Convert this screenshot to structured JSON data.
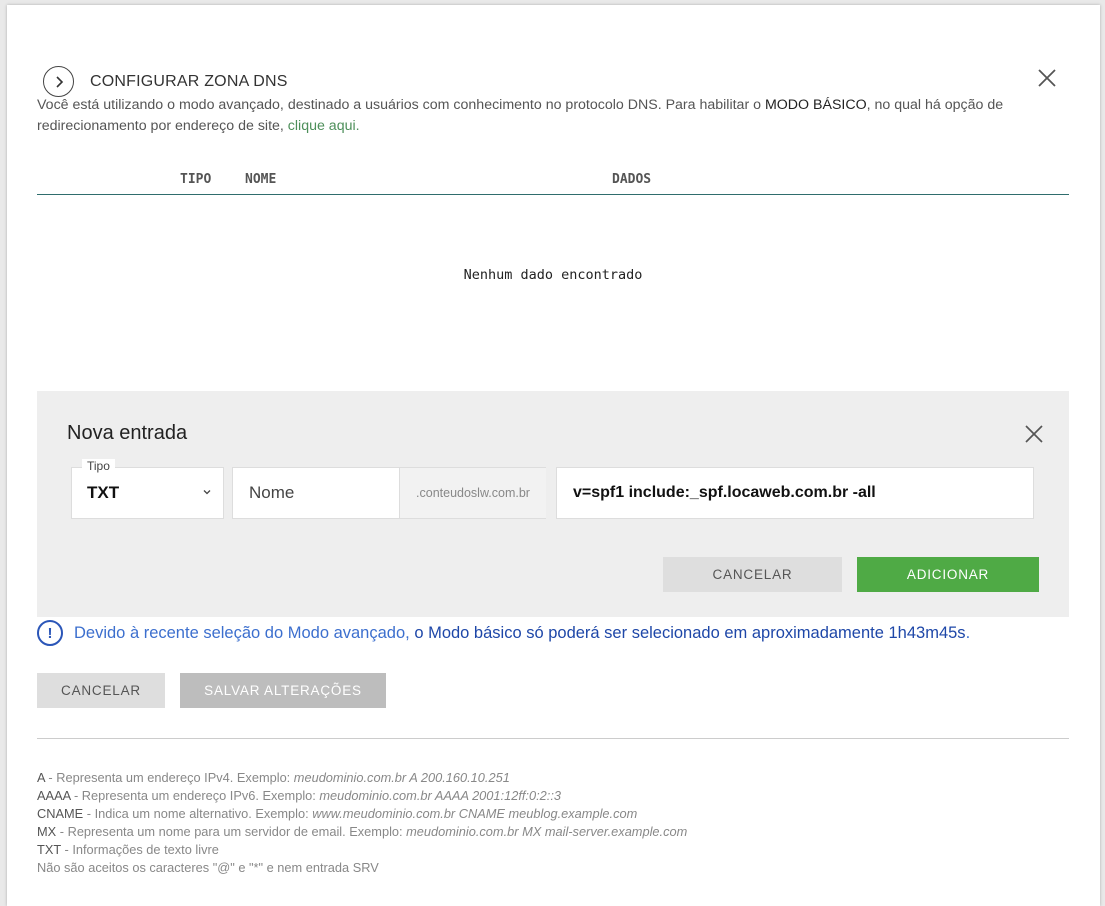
{
  "dialog": {
    "title": "CONFIGURAR ZONA DNS",
    "intro_text_1": "Você está utilizando o modo avançado, destinado a usuários com conhecimento no protocolo DNS. Para habilitar o ",
    "intro_mode": "MODO BÁSICO",
    "intro_text_2": ", no qual há opção de redirecionamento por endereço de site, ",
    "intro_link": "clique aqui."
  },
  "table": {
    "columns": [
      "TIPO",
      "NOME",
      "DADOS"
    ],
    "empty_message": "Nenhum dado encontrado"
  },
  "new_entry": {
    "title": "Nova entrada",
    "tipo_label": "Tipo",
    "tipo_value": "TXT",
    "nome_placeholder": "Nome",
    "domain_suffix": ".conteudoslw.com.br",
    "dados_value": "v=spf1 include:_spf.locaweb.com.br -all",
    "cancel_label": "CANCELAR",
    "add_label": "ADICIONAR"
  },
  "notice": {
    "icon": "!",
    "text_1": "Devido à recente seleção do Modo avançado, ",
    "text_2": "o Modo básico só poderá ser selecionado em aproximadamente 1h43m45s",
    "text_3": "."
  },
  "actions": {
    "cancel_label": "CANCELAR",
    "save_label": "SALVAR ALTERAÇÕES"
  },
  "legend": [
    {
      "key": "A",
      "desc": " - Representa um endereço IPv4. Exemplo: ",
      "example": "meudominio.com.br A 200.160.10.251"
    },
    {
      "key": "AAAA",
      "desc": " - Representa um endereço IPv6. Exemplo: ",
      "example": "meudominio.com.br AAAA 2001:12ff:0:2::3"
    },
    {
      "key": "CNAME",
      "desc": " - Indica um nome alternativo. Exemplo: ",
      "example": "www.meudominio.com.br CNAME meublog.example.com"
    },
    {
      "key": "MX",
      "desc": " - Representa um nome para um servidor de email. Exemplo: ",
      "example": "meudominio.com.br MX mail-server.example.com"
    },
    {
      "key": "TXT",
      "desc": " - Informações de texto livre",
      "example": ""
    }
  ],
  "legend_note": "Não são aceitos os caracteres \"@\" e \"*\" e nem entrada SRV",
  "colors": {
    "accent_green": "#4faa45",
    "link_green": "#4d8f5a",
    "notice_blue": "#3c6fce",
    "panel_bg": "#eeeeee"
  }
}
